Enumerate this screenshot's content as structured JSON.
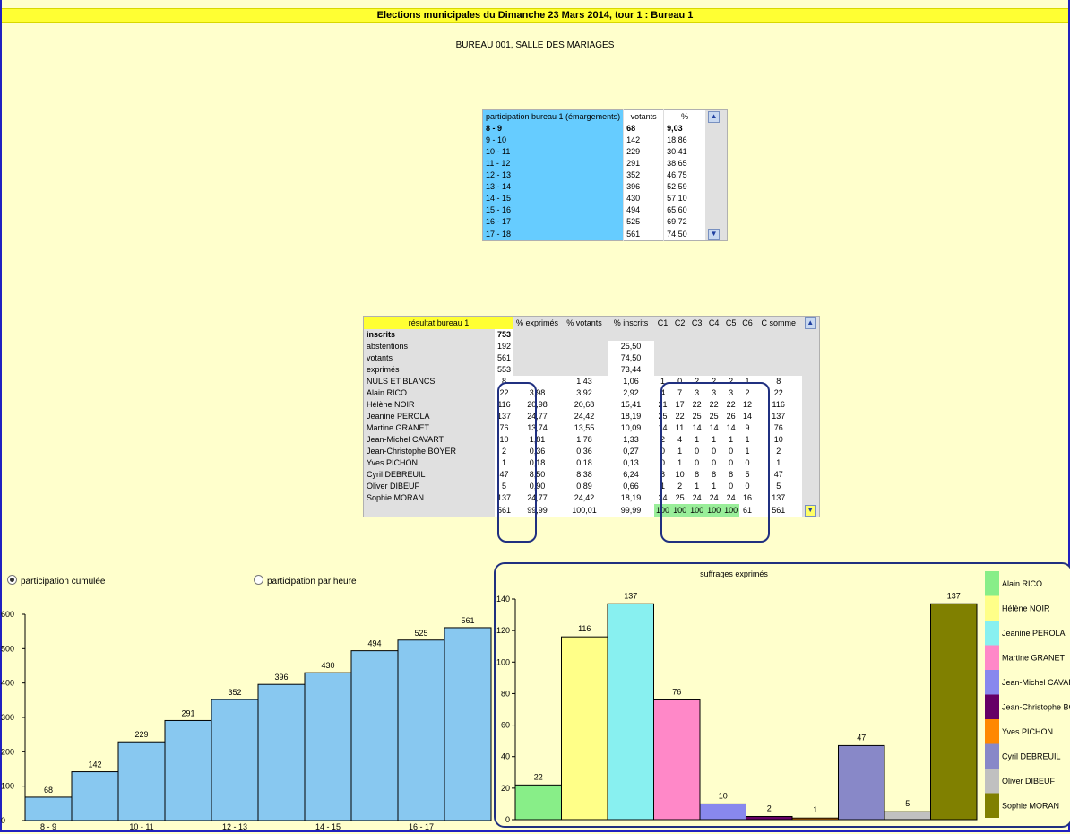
{
  "title": "Elections municipales du Dimanche 23 Mars 2014, tour 1 :  Bureau 1",
  "subtitle": "BUREAU 001, SALLE DES MARIAGES",
  "participation": {
    "header": [
      "participation bureau 1 (émargements)",
      "votants",
      "%"
    ],
    "rows": [
      [
        "8 - 9",
        "68",
        "9,03"
      ],
      [
        "9 - 10",
        "142",
        "18,86"
      ],
      [
        "10 - 11",
        "229",
        "30,41"
      ],
      [
        "11 - 12",
        "291",
        "38,65"
      ],
      [
        "12 - 13",
        "352",
        "46,75"
      ],
      [
        "13 - 14",
        "396",
        "52,59"
      ],
      [
        "14 - 15",
        "430",
        "57,10"
      ],
      [
        "15 - 16",
        "494",
        "65,60"
      ],
      [
        "16 - 17",
        "525",
        "69,72"
      ],
      [
        "17 - 18",
        "561",
        "74,50"
      ]
    ]
  },
  "results": {
    "header": [
      "résultat bureau 1",
      "",
      "% exprimés",
      "% votants",
      "% inscrits",
      "C1",
      "C2",
      "C3",
      "C4",
      "C5",
      "C6",
      "C somme"
    ],
    "rows": [
      [
        "inscrits",
        "753",
        "",
        "",
        "",
        "",
        "",
        "",
        "",
        "",
        "",
        ""
      ],
      [
        "abstentions",
        "192",
        "",
        "",
        "25,50",
        "",
        "",
        "",
        "",
        "",
        "",
        ""
      ],
      [
        "votants",
        "561",
        "",
        "",
        "74,50",
        "",
        "",
        "",
        "",
        "",
        "",
        ""
      ],
      [
        "exprimés",
        "553",
        "",
        "",
        "73,44",
        "",
        "",
        "",
        "",
        "",
        "",
        ""
      ],
      [
        "NULS ET BLANCS",
        "8",
        "",
        "1,43",
        "1,06",
        "1",
        "0",
        "2",
        "2",
        "2",
        "1",
        "8"
      ],
      [
        "Alain RICO",
        "22",
        "3,98",
        "3,92",
        "2,92",
        "4",
        "7",
        "3",
        "3",
        "3",
        "2",
        "22"
      ],
      [
        "Hélène NOIR",
        "116",
        "20,98",
        "20,68",
        "15,41",
        "21",
        "17",
        "22",
        "22",
        "22",
        "12",
        "116"
      ],
      [
        "Jeanine PEROLA",
        "137",
        "24,77",
        "24,42",
        "18,19",
        "25",
        "22",
        "25",
        "25",
        "26",
        "14",
        "137"
      ],
      [
        "Martine GRANET",
        "76",
        "13,74",
        "13,55",
        "10,09",
        "14",
        "11",
        "14",
        "14",
        "14",
        "9",
        "76"
      ],
      [
        "Jean-Michel CAVART",
        "10",
        "1,81",
        "1,78",
        "1,33",
        "2",
        "4",
        "1",
        "1",
        "1",
        "1",
        "10"
      ],
      [
        "Jean-Christophe BOYER",
        "2",
        "0,36",
        "0,36",
        "0,27",
        "0",
        "1",
        "0",
        "0",
        "0",
        "1",
        "2"
      ],
      [
        "Yves PICHON",
        "1",
        "0,18",
        "0,18",
        "0,13",
        "0",
        "1",
        "0",
        "0",
        "0",
        "0",
        "1"
      ],
      [
        "Cyril DEBREUIL",
        "47",
        "8,50",
        "8,38",
        "6,24",
        "8",
        "10",
        "8",
        "8",
        "8",
        "5",
        "47"
      ],
      [
        "Oliver DIBEUF",
        "5",
        "0,90",
        "0,89",
        "0,66",
        "1",
        "2",
        "1",
        "1",
        "0",
        "0",
        "5"
      ],
      [
        "Sophie MORAN",
        "137",
        "24,77",
        "24,42",
        "18,19",
        "24",
        "25",
        "24",
        "24",
        "24",
        "16",
        "137"
      ]
    ],
    "footer": [
      "",
      "561",
      "99,99",
      "100,01",
      "99,99",
      "100",
      "100",
      "100",
      "100",
      "100",
      "61",
      "561"
    ]
  },
  "radios": {
    "cumulative_label": "participation cumulée",
    "hourly_label": "participation par heure",
    "selected": "cumulative"
  },
  "chart_data": [
    {
      "type": "bar",
      "categories": [
        "8 - 9",
        "9 - 10",
        "10 - 11",
        "11 - 12",
        "12 - 13",
        "13 - 14",
        "14 - 15",
        "15 - 16",
        "16 - 17",
        "17 - 18"
      ],
      "x_tick_labels": [
        "8 - 9",
        "10 - 11",
        "12 - 13",
        "14 - 15",
        "16 - 17"
      ],
      "values": [
        68,
        142,
        229,
        291,
        352,
        396,
        430,
        494,
        525,
        561
      ],
      "ylim": [
        0,
        600
      ],
      "yticks": [
        0,
        100,
        200,
        300,
        400,
        500,
        600
      ],
      "color": "#88c8f0"
    },
    {
      "type": "bar",
      "title": "suffrages exprimés",
      "categories": [
        "Alain RICO",
        "Hélène NOIR",
        "Jeanine PEROLA",
        "Martine GRANET",
        "Jean-Michel CAVART",
        "Jean-Christophe BOYER",
        "Yves PICHON",
        "Cyril DEBREUIL",
        "Oliver DIBEUF",
        "Sophie MORAN"
      ],
      "values": [
        22,
        116,
        137,
        76,
        10,
        2,
        1,
        47,
        5,
        137
      ],
      "colors": [
        "#88ee88",
        "#ffff88",
        "#88f0f0",
        "#ff88c8",
        "#8888ee",
        "#660066",
        "#ff8800",
        "#8888c8",
        "#c0c0c0",
        "#808000"
      ],
      "ylim": [
        0,
        140
      ],
      "yticks": [
        0,
        20,
        40,
        60,
        80,
        100,
        120,
        140
      ],
      "legend": "right"
    }
  ]
}
